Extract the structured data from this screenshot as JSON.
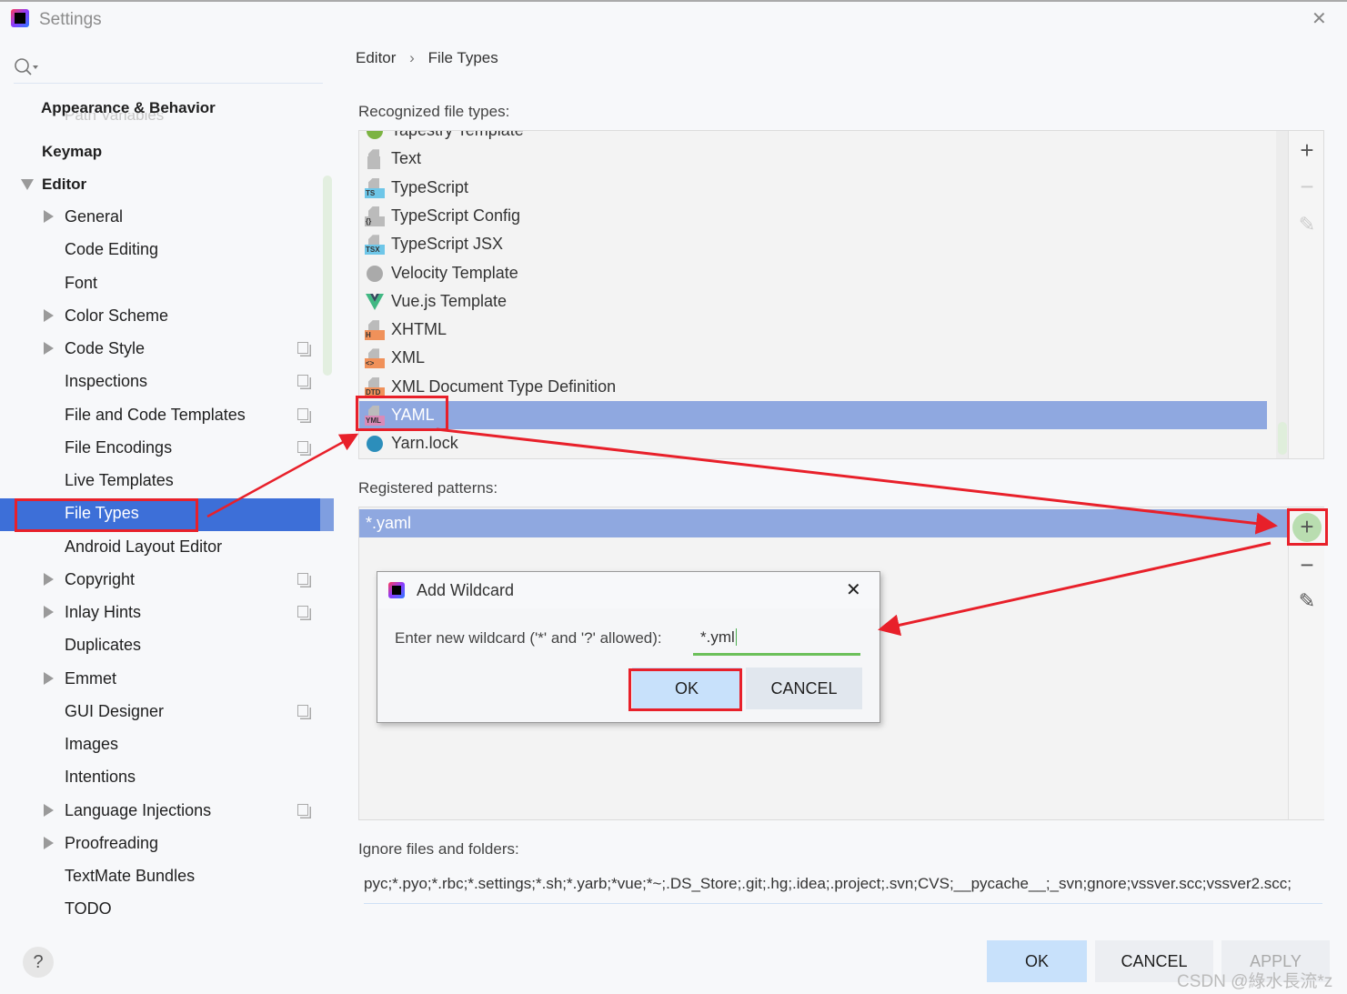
{
  "window": {
    "title": "Settings"
  },
  "sidebar": {
    "ghost_text": "Path Variables",
    "items": [
      {
        "label": "Appearance & Behavior",
        "level": 0
      },
      {
        "label": "Keymap",
        "level": 0
      },
      {
        "label": "Editor",
        "level": 0,
        "expanded": true
      },
      {
        "label": "General",
        "level": 1,
        "arrow": true
      },
      {
        "label": "Code Editing",
        "level": 1
      },
      {
        "label": "Font",
        "level": 1
      },
      {
        "label": "Color Scheme",
        "level": 1,
        "arrow": true
      },
      {
        "label": "Code Style",
        "level": 1,
        "arrow": true,
        "copy": true
      },
      {
        "label": "Inspections",
        "level": 1,
        "copy": true
      },
      {
        "label": "File and Code Templates",
        "level": 1,
        "copy": true
      },
      {
        "label": "File Encodings",
        "level": 1,
        "copy": true
      },
      {
        "label": "Live Templates",
        "level": 1
      },
      {
        "label": "File Types",
        "level": 1,
        "selected": true
      },
      {
        "label": "Android Layout Editor",
        "level": 1
      },
      {
        "label": "Copyright",
        "level": 1,
        "arrow": true,
        "copy": true
      },
      {
        "label": "Inlay Hints",
        "level": 1,
        "arrow": true,
        "copy": true
      },
      {
        "label": "Duplicates",
        "level": 1
      },
      {
        "label": "Emmet",
        "level": 1,
        "arrow": true
      },
      {
        "label": "GUI Designer",
        "level": 1,
        "copy": true
      },
      {
        "label": "Images",
        "level": 1
      },
      {
        "label": "Intentions",
        "level": 1
      },
      {
        "label": "Language Injections",
        "level": 1,
        "arrow": true,
        "copy": true
      },
      {
        "label": "Proofreading",
        "level": 1,
        "arrow": true
      },
      {
        "label": "TextMate Bundles",
        "level": 1
      },
      {
        "label": "TODO",
        "level": 1
      }
    ]
  },
  "breadcrumb": {
    "parent": "Editor",
    "sep": "›",
    "current": "File Types"
  },
  "recognized": {
    "label": "Recognized file types:",
    "items": [
      {
        "label": "Tapestry Template",
        "icon": "tapestry-icon",
        "color": "#7cb342"
      },
      {
        "label": "Text",
        "icon": "text-file-icon",
        "color": "#9e9e9e",
        "badge": ""
      },
      {
        "label": "TypeScript",
        "icon": "typescript-icon",
        "color": "#6ec6e8",
        "badge": "TS"
      },
      {
        "label": "TypeScript Config",
        "icon": "tsconfig-icon",
        "color": "#bbbbbb",
        "badge": "{}"
      },
      {
        "label": "TypeScript JSX",
        "icon": "tsx-icon",
        "color": "#6ec6e8",
        "badge": "TSX"
      },
      {
        "label": "Velocity Template",
        "icon": "velocity-icon",
        "color": "#aaaaaa"
      },
      {
        "label": "Vue.js Template",
        "icon": "vue-icon",
        "color": "#41b883"
      },
      {
        "label": "XHTML",
        "icon": "xhtml-icon",
        "color": "#f0915a",
        "badge": "H"
      },
      {
        "label": "XML",
        "icon": "xml-icon",
        "color": "#f0915a",
        "badge": "<>"
      },
      {
        "label": "XML Document Type Definition",
        "icon": "dtd-icon",
        "color": "#f0915a",
        "badge": "DTD"
      },
      {
        "label": "YAML",
        "icon": "yaml-icon",
        "color": "#d98ab8",
        "badge": "YML",
        "selected": true
      },
      {
        "label": "Yarn.lock",
        "icon": "yarn-icon",
        "color": "#2c8ebb"
      }
    ]
  },
  "patterns": {
    "label": "Registered patterns:",
    "items": [
      "*.yaml"
    ]
  },
  "ignore": {
    "label": "Ignore files and folders:",
    "value": "pyc;*.pyo;*.rbc;*.settings;*.sh;*.yarb;*vue;*~;.DS_Store;.git;.hg;.idea;.project;.svn;CVS;__pycache__;_svn;gnore;vssver.scc;vssver2.scc;"
  },
  "dialog": {
    "title": "Add Wildcard",
    "prompt": "Enter new wildcard ('*' and '?' allowed):",
    "value": "*.yml",
    "ok": "OK",
    "cancel": "CANCEL"
  },
  "footer": {
    "ok": "OK",
    "cancel": "CANCEL",
    "apply": "APPLY",
    "help": "?"
  },
  "watermark": "CSDN @綠水長流*z",
  "colors": {
    "selection": "#3d6fd8",
    "list_selection": "#8fa8e0",
    "annotation": "#e8202a",
    "ok_button": "#c8e1fb"
  }
}
